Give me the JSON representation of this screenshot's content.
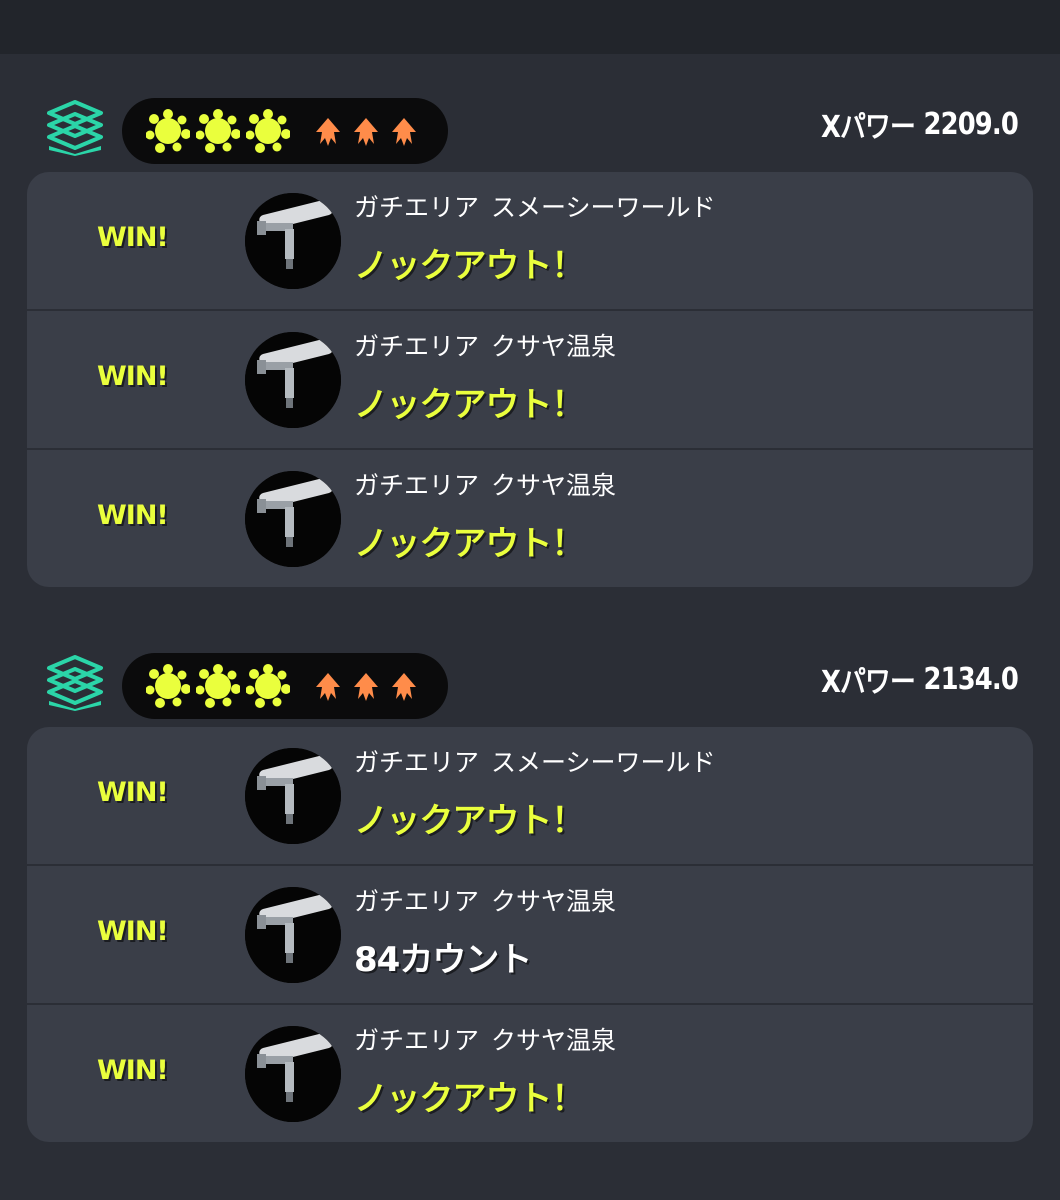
{
  "colors": {
    "win": "#eaff3d",
    "splat": "#eaff3d",
    "squid": "#ff8c4a",
    "area_icon": "#2bd5a8",
    "card_bg": "#3a3e48",
    "page_bg": "#2b2e36"
  },
  "icons": {
    "mode": "splat-zones-icon",
    "win_mark": "splat-icon",
    "squid_mark": "squid-icon",
    "weapon": "carbon-roller-icon"
  },
  "groups": [
    {
      "xpower_label": "Xパワー",
      "xpower_value": "2209.0",
      "matches": [
        {
          "result": "WIN!",
          "mode": "ガチエリア",
          "stage": "スメーシーワールド",
          "outcome": "ノックアウト！",
          "outcome_type": "knockout"
        },
        {
          "result": "WIN!",
          "mode": "ガチエリア",
          "stage": "クサヤ温泉",
          "outcome": "ノックアウト！",
          "outcome_type": "knockout"
        },
        {
          "result": "WIN!",
          "mode": "ガチエリア",
          "stage": "クサヤ温泉",
          "outcome": "ノックアウト！",
          "outcome_type": "knockout"
        }
      ]
    },
    {
      "xpower_label": "Xパワー",
      "xpower_value": "2134.0",
      "matches": [
        {
          "result": "WIN!",
          "mode": "ガチエリア",
          "stage": "スメーシーワールド",
          "outcome": "ノックアウト！",
          "outcome_type": "knockout"
        },
        {
          "result": "WIN!",
          "mode": "ガチエリア",
          "stage": "クサヤ温泉",
          "outcome": "84カウント",
          "outcome_type": "count"
        },
        {
          "result": "WIN!",
          "mode": "ガチエリア",
          "stage": "クサヤ温泉",
          "outcome": "ノックアウト！",
          "outcome_type": "knockout"
        }
      ]
    }
  ]
}
